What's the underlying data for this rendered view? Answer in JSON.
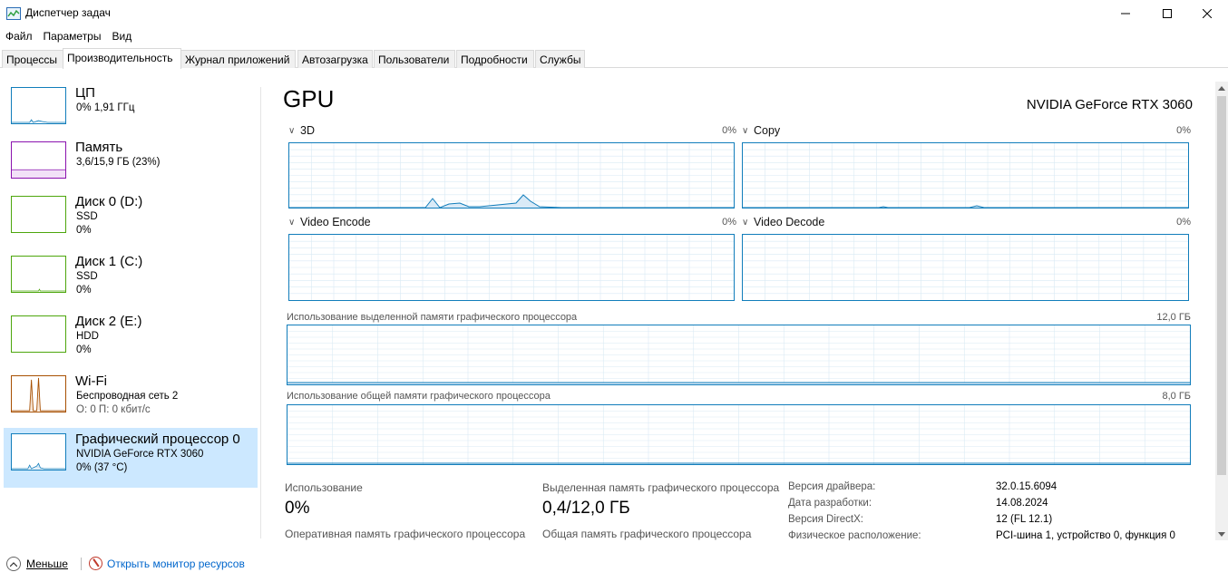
{
  "window": {
    "title": "Диспетчер задач"
  },
  "menu": [
    "Файл",
    "Параметры",
    "Вид"
  ],
  "tabs": [
    "Процессы",
    "Производительность",
    "Журнал приложений",
    "Автозагрузка",
    "Пользователи",
    "Подробности",
    "Службы"
  ],
  "sidebar": [
    {
      "name": "ЦП",
      "line1": "0% 1,91 ГГц",
      "line2": "",
      "color": "#117dbb"
    },
    {
      "name": "Память",
      "line1": "3,6/15,9 ГБ (23%)",
      "line2": "",
      "color": "#8b12ae"
    },
    {
      "name": "Диск 0 (D:)",
      "line1": "SSD",
      "line2": "0%",
      "color": "#4da60c"
    },
    {
      "name": "Диск 1 (C:)",
      "line1": "SSD",
      "line2": "0%",
      "color": "#4da60c"
    },
    {
      "name": "Диск 2 (E:)",
      "line1": "HDD",
      "line2": "0%",
      "color": "#4da60c"
    },
    {
      "name": "Wi-Fi",
      "line1": "Беспроводная сеть 2",
      "line2": "О: 0 П: 0 кбит/с",
      "color": "#a74f01"
    },
    {
      "name": "Графический процессор 0",
      "line1": "NVIDIA GeForce RTX 3060",
      "line2": "0% (37 °C)",
      "color": "#117dbb"
    }
  ],
  "main": {
    "title": "GPU",
    "model": "NVIDIA GeForce RTX 3060",
    "engines": [
      {
        "name": "3D",
        "value": "0%"
      },
      {
        "name": "Copy",
        "value": "0%"
      },
      {
        "name": "Video Encode",
        "value": "0%"
      },
      {
        "name": "Video Decode",
        "value": "0%"
      }
    ],
    "dedicated_label": "Использование выделенной памяти графического процессора",
    "dedicated_max": "12,0 ГБ",
    "shared_label": "Использование общей памяти графического процессора",
    "shared_max": "8,0 ГБ",
    "stats": {
      "usage_label": "Использование",
      "usage_value": "0%",
      "dedicated_label": "Выделенная память графического процессора",
      "dedicated_value": "0,4/12,0 ГБ",
      "ram_label": "Оперативная память графического процессора",
      "shared_label": "Общая память графического процессора"
    },
    "info": [
      {
        "label": "Версия драйвера:",
        "value": "32.0.15.6094"
      },
      {
        "label": "Дата разработки:",
        "value": "14.08.2024"
      },
      {
        "label": "Версия DirectX:",
        "value": "12 (FL 12.1)"
      },
      {
        "label": "Физическое расположение:",
        "value": "PCI-шина 1, устройство 0, функция 0"
      }
    ]
  },
  "footer": {
    "fewer": "Меньше",
    "monitor": "Открыть монитор ресурсов"
  },
  "colors": {
    "accent": "#117dbb",
    "selected": "#cce8ff",
    "link": "#0066cc"
  }
}
